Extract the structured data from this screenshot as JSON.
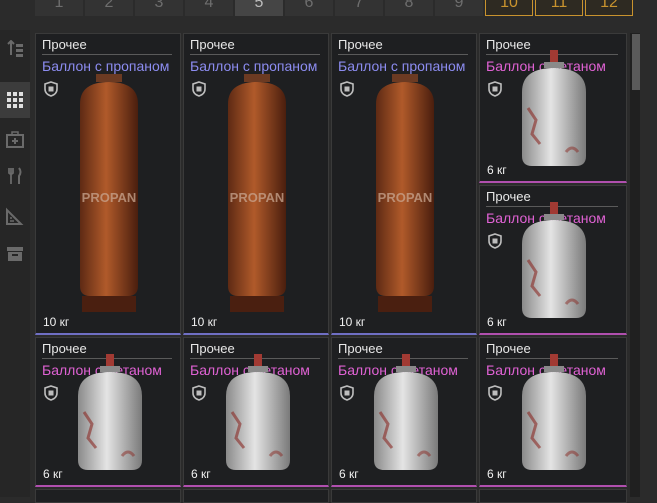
{
  "tabs": [
    {
      "label": "1"
    },
    {
      "label": "2"
    },
    {
      "label": "3"
    },
    {
      "label": "4"
    },
    {
      "label": "5"
    },
    {
      "label": "6"
    },
    {
      "label": "7"
    },
    {
      "label": "8"
    },
    {
      "label": "9"
    },
    {
      "label": "10"
    },
    {
      "label": "11"
    },
    {
      "label": "12"
    }
  ],
  "active_tab": "5",
  "sidebar": {
    "icons": [
      "sort-icon",
      "grid-icon",
      "medkit-icon",
      "food-icon",
      "ruler-icon",
      "crate-icon"
    ]
  },
  "items": [
    {
      "category": "Прочее",
      "name": "Баллон с пропаном",
      "weight": "10 кг",
      "type": "propane",
      "rarity_color": "#8c8cf0"
    },
    {
      "category": "Прочее",
      "name": "Баллон с пропаном",
      "weight": "10 кг",
      "type": "propane",
      "rarity_color": "#8c8cf0"
    },
    {
      "category": "Прочее",
      "name": "Баллон с пропаном",
      "weight": "10 кг",
      "type": "propane",
      "rarity_color": "#8c8cf0"
    },
    {
      "category": "Прочее",
      "name": "Баллон с метаном",
      "weight": "6 кг",
      "type": "methane",
      "rarity_color": "#e062d4"
    },
    {
      "category": "Прочее",
      "name": "Баллон с метаном",
      "weight": "6 кг",
      "type": "methane",
      "rarity_color": "#e062d4"
    },
    {
      "category": "Прочее",
      "name": "Баллон с метаном",
      "weight": "6 кг",
      "type": "methane",
      "rarity_color": "#e062d4"
    },
    {
      "category": "Прочее",
      "name": "Баллон с метаном",
      "weight": "6 кг",
      "type": "methane",
      "rarity_color": "#e062d4"
    },
    {
      "category": "Прочее",
      "name": "Баллон с метаном",
      "weight": "6 кг",
      "type": "methane",
      "rarity_color": "#e062d4"
    },
    {
      "category": "Прочее",
      "name": "Баллон с метаном",
      "weight": "6 кг",
      "type": "methane",
      "rarity_color": "#e062d4"
    }
  ],
  "propane_label": "PROPAN"
}
